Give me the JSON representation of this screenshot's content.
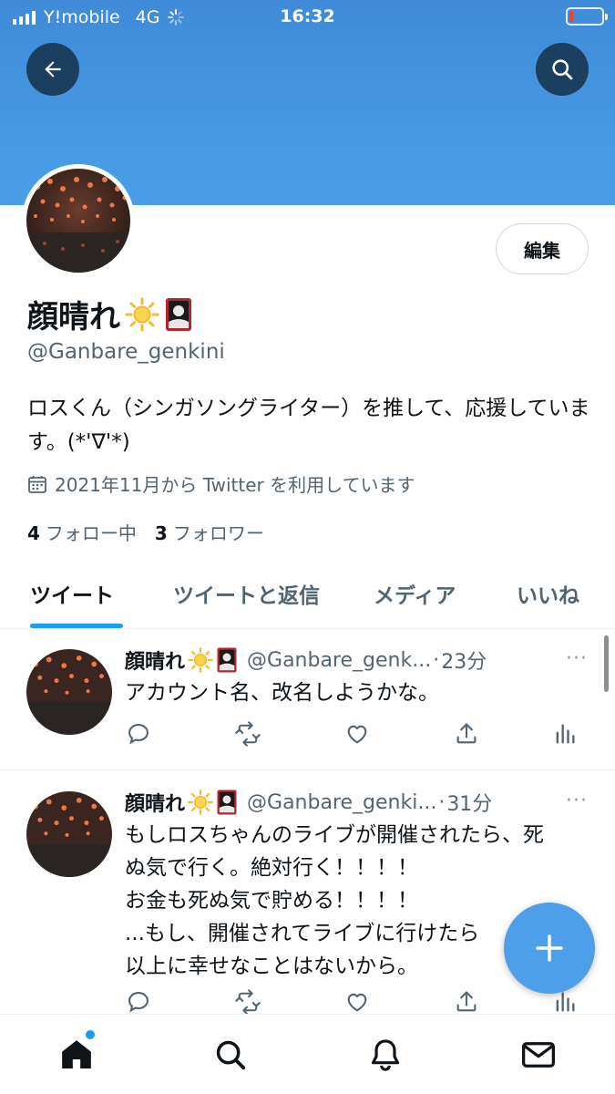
{
  "status_bar": {
    "carrier": "Y!mobile",
    "network": "4G",
    "time": "16:32"
  },
  "header": {
    "back_icon": "arrow-left-icon",
    "search_icon": "search-icon",
    "banner_color": "#4a9fe8"
  },
  "profile": {
    "display_name": "顔晴れ",
    "name_emojis": [
      "sun-icon",
      "hanafuda-icon"
    ],
    "handle": "@Ganbare_genkini",
    "edit_label": "編集",
    "bio": "ロスくん（シンガソングライター）を推して、応援しています。(*'∇'*)",
    "joined": "2021年11月から Twitter を利用しています",
    "following_count": "4",
    "following_label": "フォロー中",
    "followers_count": "3",
    "followers_label": "フォロワー"
  },
  "tabs": [
    {
      "label": "ツイート",
      "active": true
    },
    {
      "label": "ツイートと返信",
      "active": false
    },
    {
      "label": "メディア",
      "active": false
    },
    {
      "label": "いいね",
      "active": false
    }
  ],
  "tweets": [
    {
      "name": "顔晴れ",
      "handle": "@Ganbare_genk...",
      "time": "23分",
      "more": "···",
      "text": "アカウント名、改名しようかな。"
    },
    {
      "name": "顔晴れ",
      "handle": "@Ganbare_genki...",
      "time": "31分",
      "more": "···",
      "text_lines": [
        "もしロスちゃんのライブが開催されたら、死",
        "ぬ気で行く。絶対行く！！！！",
        "お金も死ぬ気で貯める！！！！",
        "...もし、開催されてライブに行けたら",
        "以上に幸せなことはないから。"
      ]
    }
  ],
  "fab_icon": "plus-icon",
  "bottom_nav": [
    "home-icon",
    "search-icon",
    "bell-icon",
    "mail-icon"
  ],
  "colors": {
    "accent": "#1d9bf0",
    "fab": "#4c9fe8",
    "secondary_text": "#536471"
  }
}
